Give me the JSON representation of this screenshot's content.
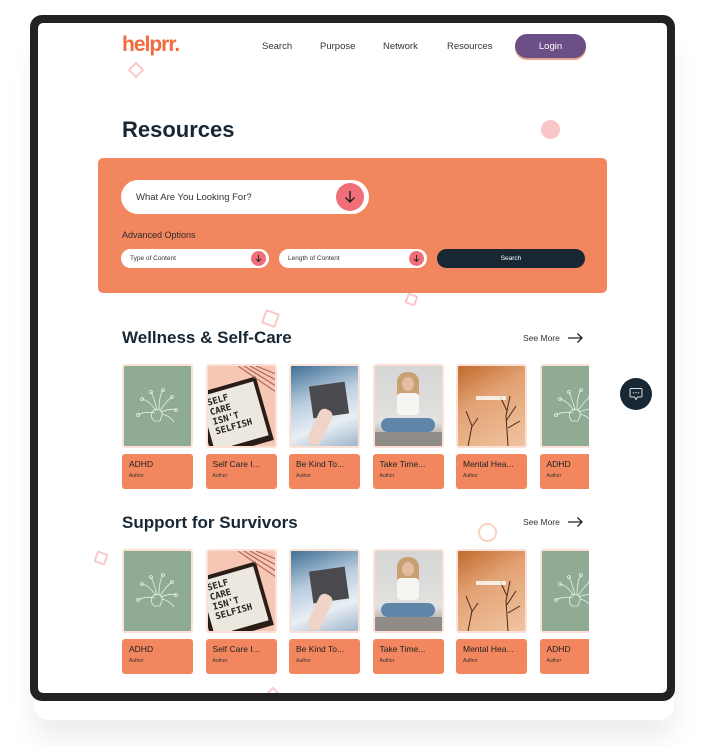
{
  "header": {
    "logo": "helprr.",
    "nav": [
      "Search",
      "Purpose",
      "Network",
      "Resources"
    ],
    "login_label": "Login"
  },
  "page": {
    "title": "Resources"
  },
  "search_panel": {
    "main_placeholder": "What Are You Looking For?",
    "advanced_label": "Advanced Options",
    "type_select": "Type of Content",
    "length_select": "Length of Content",
    "search_label": "Search"
  },
  "sections": [
    {
      "title": "Wellness & Self-Care",
      "see_more": "See More",
      "cards": [
        {
          "title": "ADHD",
          "author": "Author",
          "image": "adhd-brain-illustration"
        },
        {
          "title": "Self Care I...",
          "author": "Author",
          "image": "self-care-letterboard"
        },
        {
          "title": "Be Kind To...",
          "author": "Author",
          "image": "note-against-sky"
        },
        {
          "title": "Take Time...",
          "author": "Author",
          "image": "woman-meditating"
        },
        {
          "title": "Mental Hea...",
          "author": "Author",
          "image": "branches-orange"
        },
        {
          "title": "ADHD",
          "author": "Author",
          "image": "adhd-brain-illustration"
        }
      ]
    },
    {
      "title": "Support for Survivors",
      "see_more": "See More",
      "cards": [
        {
          "title": "ADHD",
          "author": "Author",
          "image": "adhd-brain-illustration"
        },
        {
          "title": "Self Care I...",
          "author": "Author",
          "image": "self-care-letterboard"
        },
        {
          "title": "Be Kind To...",
          "author": "Author",
          "image": "note-against-sky"
        },
        {
          "title": "Take Time...",
          "author": "Author",
          "image": "woman-meditating"
        },
        {
          "title": "Mental Hea...",
          "author": "Author",
          "image": "branches-orange"
        },
        {
          "title": "ADHD",
          "author": "Author",
          "image": "adhd-brain-illustration"
        }
      ]
    }
  ],
  "letterboard_text": [
    "SELF",
    "CARE",
    "ISN'T",
    "SELFISH"
  ],
  "colors": {
    "brand_orange": "#f2875f",
    "logo_orange": "#f26a3d",
    "login_purple": "#6b4e85",
    "navy": "#172733",
    "pink_accent": "#f06e78"
  },
  "chat": {
    "icon": "chat-bubble-icon"
  }
}
